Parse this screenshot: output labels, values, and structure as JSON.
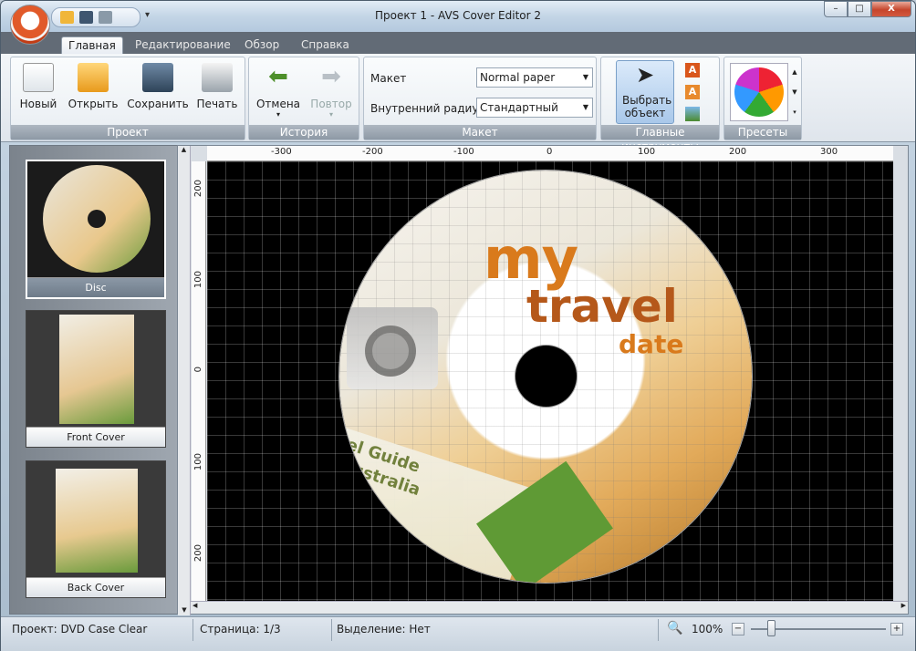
{
  "window": {
    "title": "Проект 1 - AVS Cover Editor 2",
    "min": "–",
    "max": "□",
    "close": "X"
  },
  "tabs": [
    {
      "label": "Главная",
      "active": true
    },
    {
      "label": "Редактирование"
    },
    {
      "label": "Обзор"
    },
    {
      "label": "Справка"
    }
  ],
  "ribbon": {
    "project": {
      "label": "Проект",
      "new": "Новый",
      "open": "Открыть",
      "save": "Сохранить",
      "print": "Печать"
    },
    "history": {
      "label": "История",
      "undo": "Отмена",
      "redo": "Повтор"
    },
    "layout": {
      "label": "Макет",
      "layout_label": "Макет",
      "layout_value": "Normal paper",
      "radius_label": "Внутренний радиус",
      "radius_value": "Стандартный"
    },
    "tools": {
      "label": "Главные инструменты",
      "select": "Выбрать объект"
    },
    "presets": {
      "label": "Пресеты"
    }
  },
  "thumbnails": [
    {
      "label": "Disc",
      "selected": true
    },
    {
      "label": "Front Cover"
    },
    {
      "label": "Back Cover"
    }
  ],
  "disc_art": {
    "line1": "my",
    "line2": "travel",
    "line3": "date",
    "guide": "el Guide",
    "australia": "Australia",
    "accent": "#d97a1c"
  },
  "rulers": {
    "h": [
      "-300",
      "-200",
      "-100",
      "0",
      "100",
      "200",
      "300"
    ],
    "v": [
      "200",
      "100",
      "0",
      "100",
      "200"
    ]
  },
  "status": {
    "project": "Проект: DVD Case Clear",
    "page": "Страница: 1/3",
    "selection": "Выделение: Нет",
    "zoom": "100%"
  },
  "colors": {
    "ribbon_tabs": "#626b76",
    "group_label": "#9aa4ae",
    "canvas": "#000000"
  }
}
